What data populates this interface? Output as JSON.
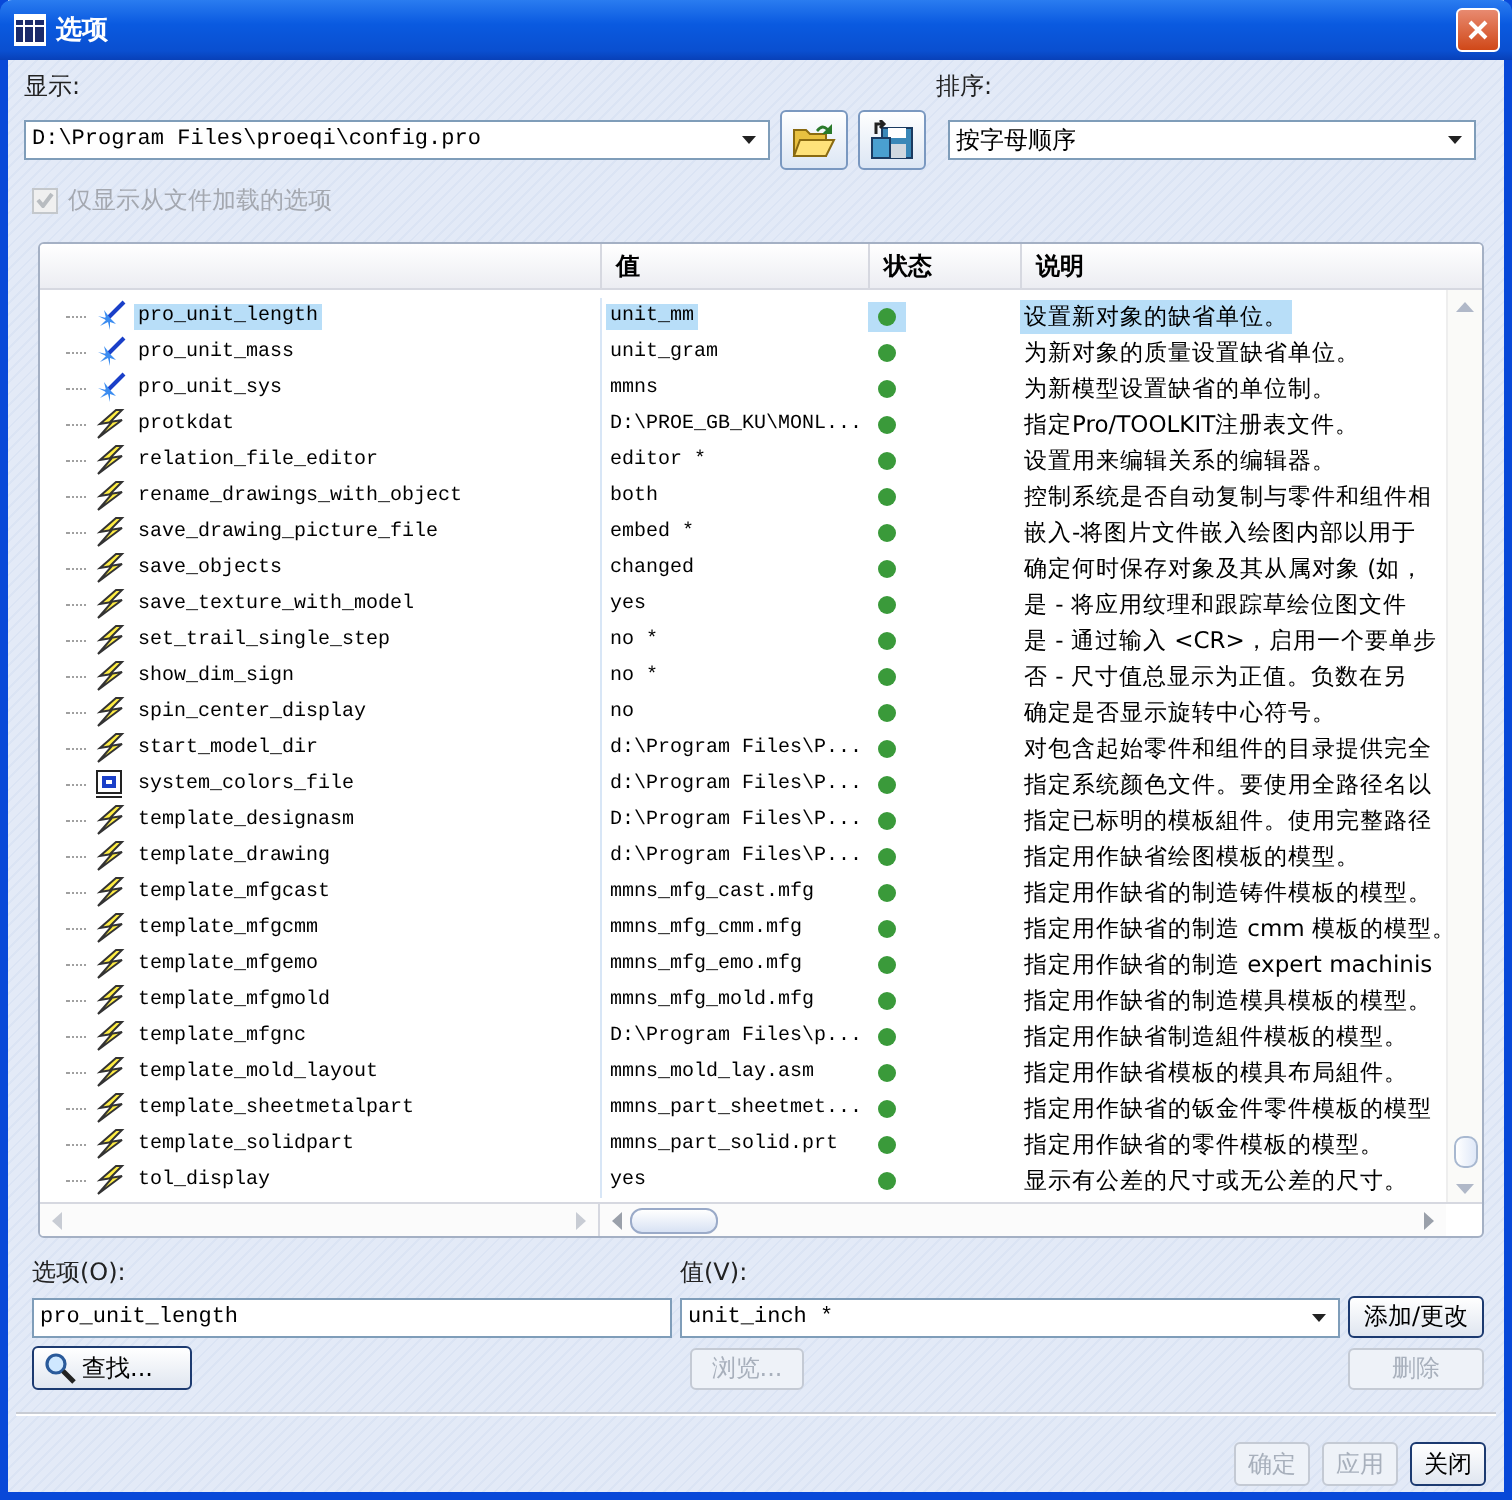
{
  "window": {
    "title": "选项"
  },
  "display": {
    "label": "显示:",
    "value": "D:\\Program Files\\proeqi\\config.pro"
  },
  "sort": {
    "label": "排序:",
    "value": "按字母顺序"
  },
  "filter_checkbox": {
    "label": "仅显示从文件加载的选项",
    "checked": true,
    "disabled": true
  },
  "table": {
    "columns": [
      {
        "label": "值"
      },
      {
        "label": "状态"
      },
      {
        "label": "说明"
      }
    ],
    "rows": [
      {
        "kind": "wand",
        "name": "pro_unit_length",
        "value": "unit_mm",
        "description": "设置新对象的缺省单位。",
        "selected": true
      },
      {
        "kind": "wand",
        "name": "pro_unit_mass",
        "value": "unit_gram",
        "description": "为新对象的质量设置缺省单位。",
        "selected": false
      },
      {
        "kind": "wand",
        "name": "pro_unit_sys",
        "value": "mmns",
        "description": "为新模型设置缺省的单位制。",
        "selected": false
      },
      {
        "kind": "bolt",
        "name": "protkdat",
        "value": "D:\\PROE_GB_KU\\MONL...",
        "description": "指定Pro/TOOLKIT注册表文件。",
        "selected": false
      },
      {
        "kind": "bolt",
        "name": "relation_file_editor",
        "value": "editor *",
        "description": "设置用来编辑关系的编辑器。",
        "selected": false
      },
      {
        "kind": "bolt",
        "name": "rename_drawings_with_object",
        "value": "both",
        "description": "控制系统是否自动复制与零件和组件相",
        "selected": false
      },
      {
        "kind": "bolt",
        "name": "save_drawing_picture_file",
        "value": "embed *",
        "description": "嵌入-将图片文件嵌入绘图内部以用于",
        "selected": false
      },
      {
        "kind": "bolt",
        "name": "save_objects",
        "value": "changed",
        "description": "确定何时保存对象及其从属对象 (如，",
        "selected": false
      },
      {
        "kind": "bolt",
        "name": "save_texture_with_model",
        "value": "yes",
        "description": "是 - 将应用纹理和跟踪草绘位图文件",
        "selected": false
      },
      {
        "kind": "bolt",
        "name": "set_trail_single_step",
        "value": "no *",
        "description": "是 - 通过输入 <CR>，启用一个要单步",
        "selected": false
      },
      {
        "kind": "bolt",
        "name": "show_dim_sign",
        "value": "no *",
        "description": "否 - 尺寸值总显示为正值。负数在另",
        "selected": false
      },
      {
        "kind": "bolt",
        "name": "spin_center_display",
        "value": "no",
        "description": "确定是否显示旋转中心符号。",
        "selected": false
      },
      {
        "kind": "bolt",
        "name": "start_model_dir",
        "value": "d:\\Program Files\\P...",
        "description": "对包含起始零件和组件的目录提供完全",
        "selected": false
      },
      {
        "kind": "file",
        "name": "system_colors_file",
        "value": "d:\\Program Files\\P...",
        "description": "指定系统颜色文件。要使用全路径名以",
        "selected": false
      },
      {
        "kind": "bolt",
        "name": "template_designasm",
        "value": "D:\\Program Files\\P...",
        "description": "指定已标明的模板組件。使用完整路径",
        "selected": false
      },
      {
        "kind": "bolt",
        "name": "template_drawing",
        "value": "d:\\Program Files\\P...",
        "description": "指定用作缺省绘图模板的模型。",
        "selected": false
      },
      {
        "kind": "bolt",
        "name": "template_mfgcast",
        "value": "mmns_mfg_cast.mfg",
        "description": "指定用作缺省的制造铸件模板的模型。",
        "selected": false
      },
      {
        "kind": "bolt",
        "name": "template_mfgcmm",
        "value": "mmns_mfg_cmm.mfg",
        "description": "指定用作缺省的制造 cmm 模板的模型。",
        "selected": false
      },
      {
        "kind": "bolt",
        "name": "template_mfgemo",
        "value": "mmns_mfg_emo.mfg",
        "description": "指定用作缺省的制造 expert machinis",
        "selected": false
      },
      {
        "kind": "bolt",
        "name": "template_mfgmold",
        "value": "mmns_mfg_mold.mfg",
        "description": "指定用作缺省的制造模具模板的模型。",
        "selected": false
      },
      {
        "kind": "bolt",
        "name": "template_mfgnc",
        "value": "D:\\Program Files\\p...",
        "description": "指定用作缺省制造組件模板的模型。",
        "selected": false
      },
      {
        "kind": "bolt",
        "name": "template_mold_layout",
        "value": "mmns_mold_lay.asm",
        "description": "指定用作缺省模板的模具布局組件。",
        "selected": false
      },
      {
        "kind": "bolt",
        "name": "template_sheetmetalpart",
        "value": "mmns_part_sheetmet...",
        "description": "指定用作缺省的钣金件零件模板的模型",
        "selected": false
      },
      {
        "kind": "bolt",
        "name": "template_solidpart",
        "value": "mmns_part_solid.prt",
        "description": "指定用作缺省的零件模板的模型。",
        "selected": false
      },
      {
        "kind": "bolt",
        "name": "tol_display",
        "value": "yes",
        "description": "显示有公差的尺寸或无公差的尺寸。",
        "selected": false
      }
    ]
  },
  "editor": {
    "option_label": "选项(O):",
    "option_value": "pro_unit_length",
    "value_label": "值(V):",
    "value_value": "unit_inch *",
    "add_button": {
      "label": "添加/更改",
      "disabled": false
    },
    "find_button": {
      "label": "查找...",
      "disabled": false
    },
    "browse_button": {
      "label": "浏览...",
      "disabled": true
    },
    "delete_button": {
      "label": "删除",
      "disabled": true
    }
  },
  "footer_buttons": [
    {
      "label": "确定",
      "disabled": true
    },
    {
      "label": "应用",
      "disabled": true
    },
    {
      "label": "关闭",
      "disabled": false
    }
  ]
}
